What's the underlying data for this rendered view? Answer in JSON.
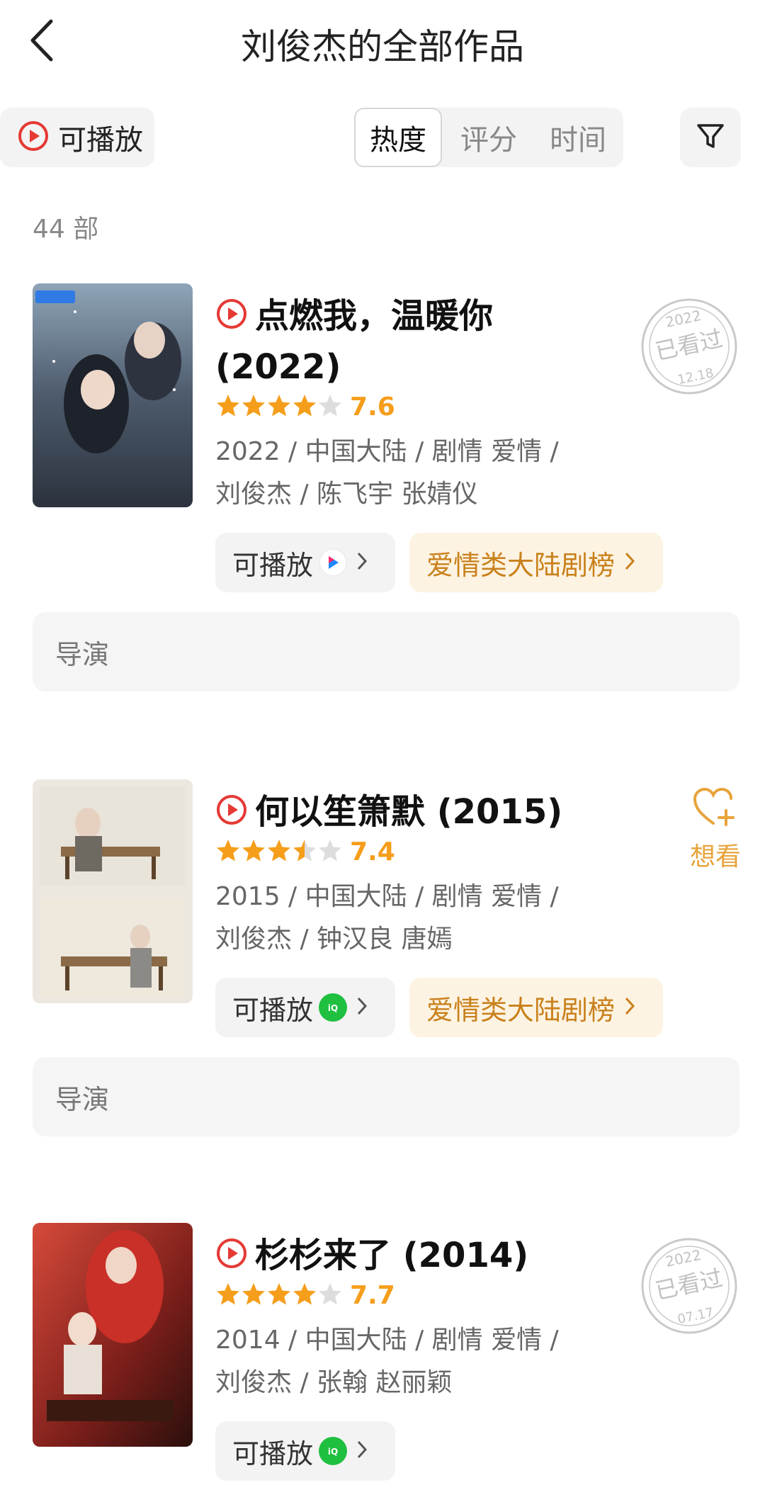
{
  "header": {
    "title": "刘俊杰的全部作品"
  },
  "filters": {
    "playable_label": "可播放",
    "sort_tabs": [
      "热度",
      "评分",
      "时间"
    ],
    "active_sort": "热度"
  },
  "count_label": "44 部",
  "colors": {
    "accent": "#e53935",
    "star": "#f59e1b",
    "rank_text": "#c9811c",
    "rank_bg": "#fdf3e2"
  },
  "items": [
    {
      "title": "点燃我，温暖你 (2022)",
      "title_line1": "点燃我，温暖你",
      "title_line2": "(2022)",
      "stars": 4,
      "half_star": false,
      "score": "7.6",
      "meta_line1": "2022 / 中国大陆 / 剧情 爱情 /",
      "meta_line2": "刘俊杰 / 陈飞宇 张婧仪",
      "play_label": "可播放",
      "platform_icon": "youku-icon",
      "rank_label": "爱情类大陆剧榜",
      "director_label": "导演",
      "stamp": {
        "year": "2022",
        "text": "已看过",
        "date": "12.18"
      }
    },
    {
      "title": "何以笙箫默 (2015)",
      "stars": 3,
      "half_star": true,
      "score": "7.4",
      "meta_line1": "2015 / 中国大陆 / 剧情 爱情 /",
      "meta_line2": "刘俊杰 / 钟汉良 唐嫣",
      "play_label": "可播放",
      "platform_icon": "iqiyi-icon",
      "rank_label": "爱情类大陆剧榜",
      "director_label": "导演",
      "want_label": "想看"
    },
    {
      "title": "杉杉来了 (2014)",
      "stars": 4,
      "half_star": false,
      "score": "7.7",
      "meta_line1": "2014 / 中国大陆 / 剧情 爱情 /",
      "meta_line2": "刘俊杰 / 张翰 赵丽颖",
      "play_label": "可播放",
      "platform_icon": "iqiyi-icon",
      "stamp": {
        "year": "2022",
        "text": "已看过",
        "date": "07.17"
      }
    }
  ]
}
